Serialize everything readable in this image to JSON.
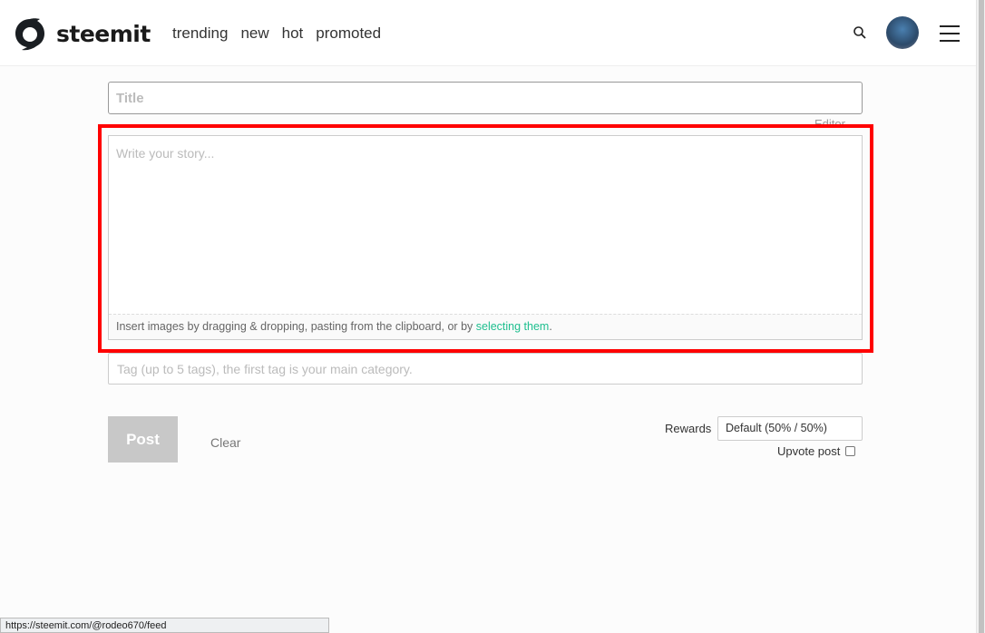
{
  "header": {
    "brand": "steemit",
    "nav": [
      "trending",
      "new",
      "hot",
      "promoted"
    ]
  },
  "editor": {
    "title_placeholder": "Title",
    "editor_link": "Editor",
    "story_placeholder": "Write your story...",
    "dropzone_text": "Insert images by dragging & dropping, pasting from the clipboard, or by ",
    "dropzone_link": "selecting them",
    "dropzone_end": ".",
    "tag_placeholder": "Tag (up to 5 tags), the first tag is your main category.",
    "post_label": "Post",
    "clear_label": "Clear",
    "rewards_label": "Rewards",
    "rewards_value": "Default (50% / 50%)",
    "upvote_label": "Upvote post",
    "upvote_checked": false
  },
  "status_bar": "https://steemit.com/@rodeo670/feed",
  "colors": {
    "highlight": "#ff0000",
    "link": "#1fbf8f"
  }
}
